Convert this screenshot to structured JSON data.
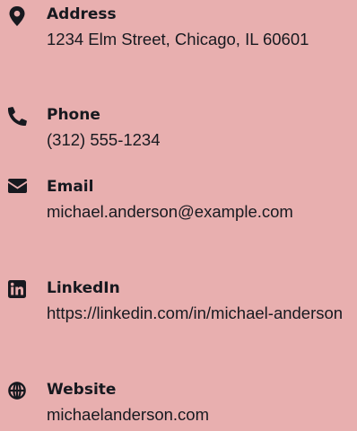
{
  "contact": {
    "items": [
      {
        "icon": "map-marker-icon",
        "label": "Address",
        "value": "1234 Elm Street, Chicago, IL 60601"
      },
      {
        "icon": "phone-icon",
        "label": "Phone",
        "value": "(312) 555-1234"
      },
      {
        "icon": "envelope-icon",
        "label": "Email",
        "value": "michael.anderson@example.com"
      },
      {
        "icon": "linkedin-icon",
        "label": "LinkedIn",
        "value": "https://linkedin.com/in/michael-anderson"
      },
      {
        "icon": "globe-icon",
        "label": "Website",
        "value": "michaelanderson.com"
      }
    ]
  }
}
